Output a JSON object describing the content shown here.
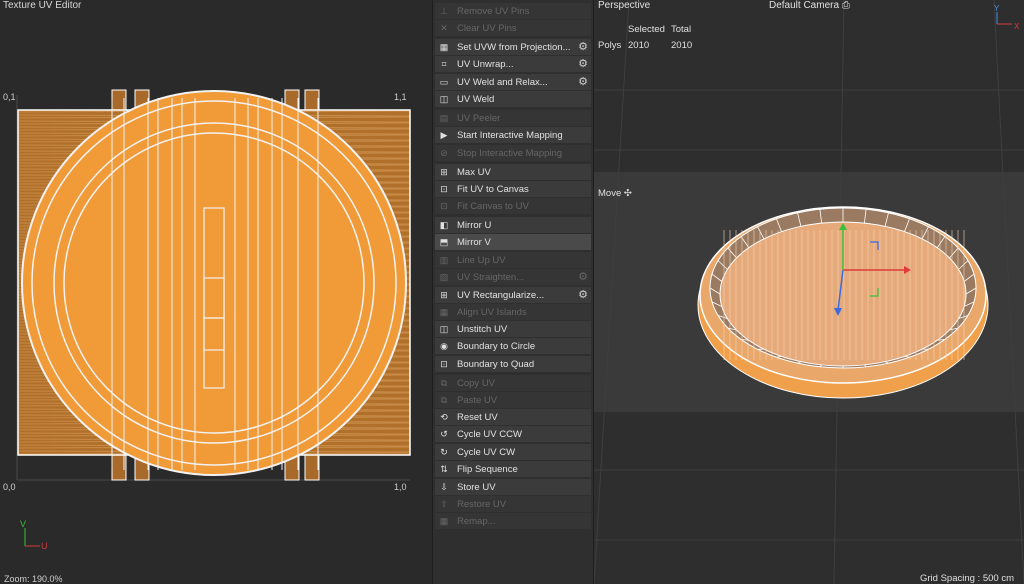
{
  "uv_editor": {
    "title": "Texture UV Editor",
    "corner_tl": "0,1",
    "corner_tr": "1,1",
    "corner_bl": "0,0",
    "corner_br": "1,0",
    "zoom_label": "Zoom: 190.0%",
    "axis_v": "V",
    "axis_u": "U"
  },
  "commands": [
    {
      "label": "Remove UV Pins",
      "icon": "pin-icon",
      "glyph": "⊥",
      "disabled": true,
      "gear": false
    },
    {
      "label": "Clear UV Pins",
      "icon": "close-icon",
      "glyph": "✕",
      "disabled": true,
      "gear": false
    },
    {
      "label": "Set UVW from Projection...",
      "icon": "projection-icon",
      "glyph": "▦",
      "disabled": false,
      "gear": true
    },
    {
      "label": "UV Unwrap...",
      "icon": "unwrap-icon",
      "glyph": "⌗",
      "disabled": false,
      "gear": true
    },
    {
      "label": "UV Weld and Relax...",
      "icon": "weld-relax-icon",
      "glyph": "▭",
      "disabled": false,
      "gear": true
    },
    {
      "label": "UV Weld",
      "icon": "weld-icon",
      "glyph": "◫",
      "disabled": false,
      "gear": false
    },
    {
      "label": "UV Peeler",
      "icon": "peeler-icon",
      "glyph": "▤",
      "disabled": true,
      "gear": false
    },
    {
      "label": "Start Interactive Mapping",
      "icon": "play-icon",
      "glyph": "▶",
      "disabled": false,
      "gear": false
    },
    {
      "label": "Stop Interactive Mapping",
      "icon": "stop-icon",
      "glyph": "⊘",
      "disabled": true,
      "gear": false
    },
    {
      "label": "Max UV",
      "icon": "max-uv-icon",
      "glyph": "⊞",
      "disabled": false,
      "gear": false
    },
    {
      "label": "Fit UV to Canvas",
      "icon": "fit-uv-icon",
      "glyph": "⊡",
      "disabled": false,
      "gear": false
    },
    {
      "label": "Fit Canvas to UV",
      "icon": "fit-canvas-icon",
      "glyph": "⊡",
      "disabled": true,
      "gear": false
    },
    {
      "label": "Mirror U",
      "icon": "mirror-u-icon",
      "glyph": "◧",
      "disabled": false,
      "gear": false
    },
    {
      "label": "Mirror V",
      "icon": "mirror-v-icon",
      "glyph": "⬒",
      "disabled": false,
      "gear": false,
      "active": true
    },
    {
      "label": "Line Up UV",
      "icon": "line-up-icon",
      "glyph": "▥",
      "disabled": true,
      "gear": false
    },
    {
      "label": "UV Straighten...",
      "icon": "straighten-icon",
      "glyph": "▧",
      "disabled": true,
      "gear": true
    },
    {
      "label": "UV Rectangularize...",
      "icon": "rectangularize-icon",
      "glyph": "⊞",
      "disabled": false,
      "gear": true
    },
    {
      "label": "Align UV Islands",
      "icon": "align-icon",
      "glyph": "▦",
      "disabled": true,
      "gear": false
    },
    {
      "label": "Unstitch UV",
      "icon": "unstitch-icon",
      "glyph": "◫",
      "disabled": false,
      "gear": false
    },
    {
      "label": "Boundary to Circle",
      "icon": "circle-icon",
      "glyph": "◉",
      "disabled": false,
      "gear": false
    },
    {
      "label": "Boundary to Quad",
      "icon": "quad-icon",
      "glyph": "⊡",
      "disabled": false,
      "gear": false
    },
    {
      "label": "Copy UV",
      "icon": "copy-icon",
      "glyph": "⧉",
      "disabled": true,
      "gear": false
    },
    {
      "label": "Paste UV",
      "icon": "paste-icon",
      "glyph": "⧉",
      "disabled": true,
      "gear": false
    },
    {
      "label": "Reset UV",
      "icon": "reset-icon",
      "glyph": "⟲",
      "disabled": false,
      "gear": false
    },
    {
      "label": "Cycle UV CCW",
      "icon": "cycle-ccw-icon",
      "glyph": "↺",
      "disabled": false,
      "gear": false
    },
    {
      "label": "Cycle UV CW",
      "icon": "cycle-cw-icon",
      "glyph": "↻",
      "disabled": false,
      "gear": false
    },
    {
      "label": "Flip Sequence",
      "icon": "flip-icon",
      "glyph": "⇅",
      "disabled": false,
      "gear": false
    },
    {
      "label": "Store UV",
      "icon": "store-icon",
      "glyph": "⇩",
      "disabled": false,
      "gear": false
    },
    {
      "label": "Restore UV",
      "icon": "restore-icon",
      "glyph": "⇧",
      "disabled": true,
      "gear": false
    },
    {
      "label": "Remap...",
      "icon": "remap-icon",
      "glyph": "▦",
      "disabled": true,
      "gear": false
    }
  ],
  "viewport": {
    "title": "Perspective",
    "camera": "Default Camera",
    "stats": {
      "col_selected": "Selected",
      "col_total": "Total",
      "row_label": "Polys",
      "selected": "2010",
      "total": "2010"
    },
    "tool": "Move",
    "grid_spacing": "Grid Spacing : 500 cm",
    "axis_y": "Y",
    "axis_x": "X"
  },
  "colors": {
    "uv_fill": "#f0a040",
    "uv_wire": "#ffffff",
    "mesh_fill": "#e8a060",
    "mesh_wire": "#f5f5f5"
  }
}
